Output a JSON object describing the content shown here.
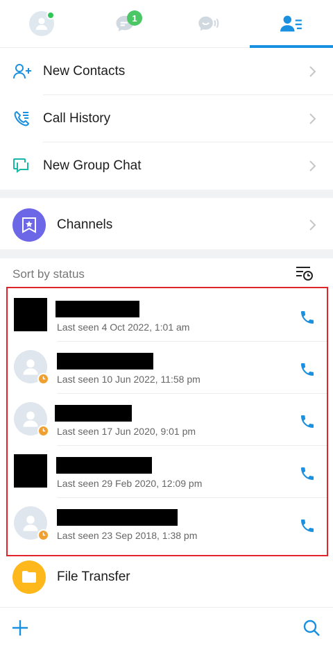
{
  "tabs": [
    {
      "name": "profile",
      "active": false,
      "online": true
    },
    {
      "name": "chats",
      "active": false,
      "badge": "1"
    },
    {
      "name": "meet",
      "active": false
    },
    {
      "name": "contacts",
      "active": true
    }
  ],
  "menu": {
    "new_contacts": "New Contacts",
    "call_history": "Call History",
    "new_group_chat": "New Group Chat",
    "channels": "Channels",
    "file_transfer": "File Transfer"
  },
  "sort": {
    "label": "Sort by status"
  },
  "contacts": [
    {
      "last_seen": "Last seen 4 Oct 2022, 1:01 am",
      "avatar": "redacted"
    },
    {
      "last_seen": "Last seen 10 Jun 2022, 11:58 pm",
      "avatar": "default"
    },
    {
      "last_seen": "Last seen 17 Jun 2020, 9:01 pm",
      "avatar": "default"
    },
    {
      "last_seen": "Last seen 29 Feb 2020, 12:09 pm",
      "avatar": "redacted"
    },
    {
      "last_seen": "Last seen 23 Sep 2018, 1:38 pm",
      "avatar": "default"
    }
  ],
  "colors": {
    "accent": "#1a90e0",
    "highlight_border": "#e0242c",
    "channels": "#6c67e6",
    "file_transfer": "#ffb81c",
    "status_away": "#f0a030",
    "badge": "#4cc766"
  }
}
